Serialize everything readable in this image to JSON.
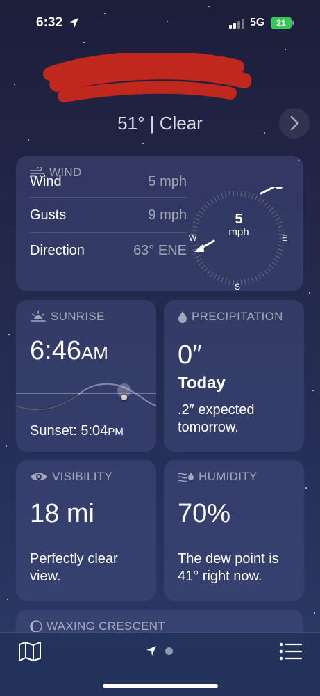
{
  "status_bar": {
    "time": "6:32",
    "network": "5G",
    "battery": "21"
  },
  "header": {
    "location": "",
    "summary": "51° | Clear"
  },
  "wind": {
    "title": "WIND",
    "rows": [
      {
        "label": "Wind",
        "value": "5 mph"
      },
      {
        "label": "Gusts",
        "value": "9 mph"
      },
      {
        "label": "Direction",
        "value": "63° ENE"
      }
    ],
    "speed": "5",
    "speed_unit": "mph",
    "compass": {
      "west": "W",
      "east": "E",
      "south": "S"
    }
  },
  "sunrise": {
    "title": "SUNRISE",
    "time": "6:46",
    "ampm": "AM",
    "sunset_label": "Sunset: 5:04",
    "sunset_ampm": "PM"
  },
  "precipitation": {
    "title": "PRECIPITATION",
    "value": "0″",
    "period": "Today",
    "note": ".2″ expected tomorrow."
  },
  "visibility": {
    "title": "VISIBILITY",
    "value": "18 mi",
    "note": "Perfectly clear view."
  },
  "humidity": {
    "title": "HUMIDITY",
    "value": "70%",
    "note": "The dew point is 41° right now."
  },
  "moon": {
    "title": "WAXING CRESCENT"
  },
  "icons": [
    "location-arrow-icon",
    "wind-icon",
    "sunrise-icon",
    "raindrop-icon",
    "eye-icon",
    "humidity-icon",
    "moon-icon",
    "map-icon",
    "list-icon",
    "chevron-right-icon"
  ]
}
